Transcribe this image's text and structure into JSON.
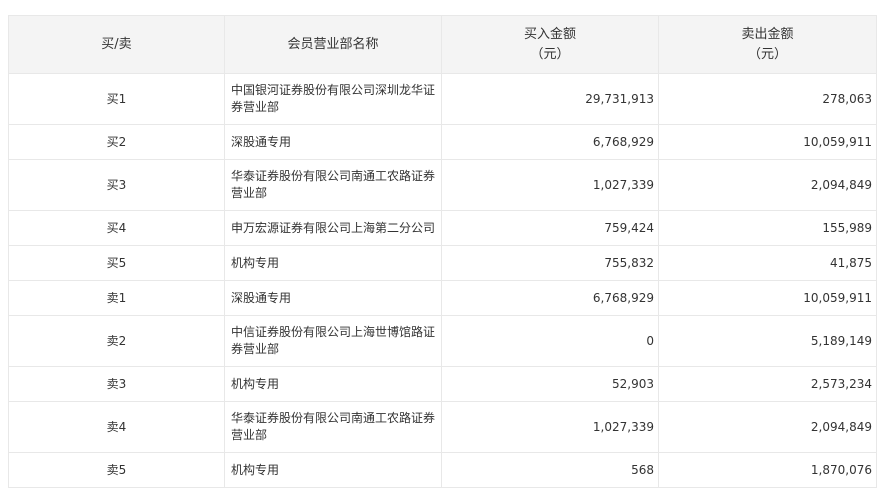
{
  "header": {
    "col_side": "买/卖",
    "col_name": "会员营业部名称",
    "col_buy_line1": "买入金额",
    "col_buy_line2": "（元）",
    "col_sell_line1": "卖出金额",
    "col_sell_line2": "（元）"
  },
  "rows": [
    {
      "side": "买1",
      "name": "中国银河证券股份有限公司深圳龙华证券营业部",
      "buy": "29,731,913",
      "sell": "278,063"
    },
    {
      "side": "买2",
      "name": "深股通专用",
      "buy": "6,768,929",
      "sell": "10,059,911"
    },
    {
      "side": "买3",
      "name": "华泰证券股份有限公司南通工农路证券营业部",
      "buy": "1,027,339",
      "sell": "2,094,849"
    },
    {
      "side": "买4",
      "name": "申万宏源证券有限公司上海第二分公司",
      "buy": "759,424",
      "sell": "155,989"
    },
    {
      "side": "买5",
      "name": "机构专用",
      "buy": "755,832",
      "sell": "41,875"
    },
    {
      "side": "卖1",
      "name": "深股通专用",
      "buy": "6,768,929",
      "sell": "10,059,911"
    },
    {
      "side": "卖2",
      "name": "中信证券股份有限公司上海世博馆路证券营业部",
      "buy": "0",
      "sell": "5,189,149"
    },
    {
      "side": "卖3",
      "name": "机构专用",
      "buy": "52,903",
      "sell": "2,573,234"
    },
    {
      "side": "卖4",
      "name": "华泰证券股份有限公司南通工农路证券营业部",
      "buy": "1,027,339",
      "sell": "2,094,849"
    },
    {
      "side": "卖5",
      "name": "机构专用",
      "buy": "568",
      "sell": "1,870,076"
    }
  ]
}
